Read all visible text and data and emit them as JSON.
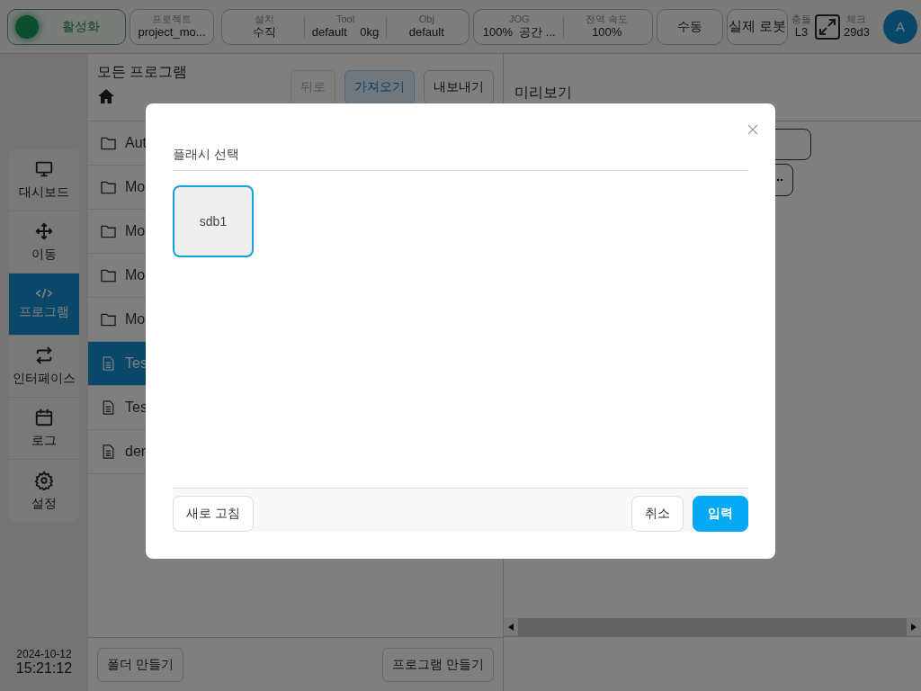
{
  "top_bar": {
    "activate": {
      "label": "활성화",
      "on": true
    },
    "project": {
      "label": "프로젝트",
      "value": "project_mo..."
    },
    "install": [
      {
        "label": "설치",
        "values": [
          "수직"
        ]
      },
      {
        "label": "Tool",
        "values": [
          "default",
          "0kg"
        ]
      },
      {
        "label": "Obj",
        "values": [
          "default"
        ]
      }
    ],
    "jog": [
      {
        "label": "JOG",
        "values": [
          "100%",
          "공간 ..."
        ]
      },
      {
        "label": "전역 속도",
        "values": [
          "100%"
        ]
      }
    ],
    "mode": "수동",
    "robot": "실제 로봇",
    "collision": {
      "label": "충돌",
      "value": "L3"
    },
    "check": {
      "label": "체크",
      "value": "29d3"
    },
    "avatar": "A"
  },
  "nav": [
    {
      "label": "대시보드",
      "selected": false
    },
    {
      "label": "이동",
      "selected": false
    },
    {
      "label": "프로그램",
      "selected": true
    },
    {
      "label": "인터페이스",
      "selected": false
    },
    {
      "label": "로그",
      "selected": false
    },
    {
      "label": "설정",
      "selected": false
    }
  ],
  "clock": {
    "date": "2024-10-12",
    "time": "15:21:12"
  },
  "programs": {
    "title": "모든 프로그램",
    "buttons": [
      {
        "label": "뒤로",
        "disabled": true,
        "selected": false
      },
      {
        "label": "가져오기",
        "disabled": false,
        "selected": true
      },
      {
        "label": "내보내기",
        "disabled": false,
        "selected": false
      }
    ],
    "items": [
      {
        "kind": "folder",
        "name": "Aut",
        "selected": false
      },
      {
        "kind": "folder",
        "name": "Mo",
        "selected": false
      },
      {
        "kind": "folder",
        "name": "Mo",
        "selected": false
      },
      {
        "kind": "folder",
        "name": "Mo",
        "selected": false
      },
      {
        "kind": "folder",
        "name": "Mo",
        "selected": false
      },
      {
        "kind": "file",
        "name": "Tes",
        "selected": true
      },
      {
        "kind": "file",
        "name": "Tes",
        "selected": false
      },
      {
        "kind": "file",
        "name": "der",
        "selected": false
      }
    ],
    "footer_buttons": [
      "폴더 만들기",
      "프로그램 만들기"
    ]
  },
  "preview": {
    "title": "미리보기"
  },
  "dialog": {
    "title": "플래시 선택",
    "devices": [
      {
        "name": "sdb1",
        "selected": true
      }
    ],
    "refresh": "새로 고침",
    "buttons": [
      {
        "label": "취소",
        "kind": "secondary"
      },
      {
        "label": "입력",
        "kind": "primary"
      }
    ]
  }
}
